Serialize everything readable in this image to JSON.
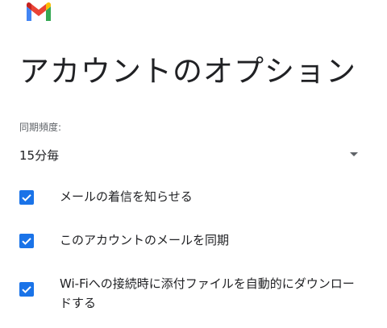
{
  "header": {
    "logo_icon": "gmail-logo-icon",
    "title": "アカウントのオプション"
  },
  "sync_frequency": {
    "label": "同期頻度:",
    "selected_value": "15分毎"
  },
  "options": [
    {
      "label": "メールの着信を知らせる",
      "checked": true
    },
    {
      "label": "このアカウントのメールを同期",
      "checked": true
    },
    {
      "label": "Wi-Fiへの接続時に添付ファイルを自動的にダウンロードする",
      "checked": true
    }
  ],
  "colors": {
    "accent": "#1a73e8",
    "text_primary": "#202124",
    "text_secondary": "#5f6368"
  }
}
